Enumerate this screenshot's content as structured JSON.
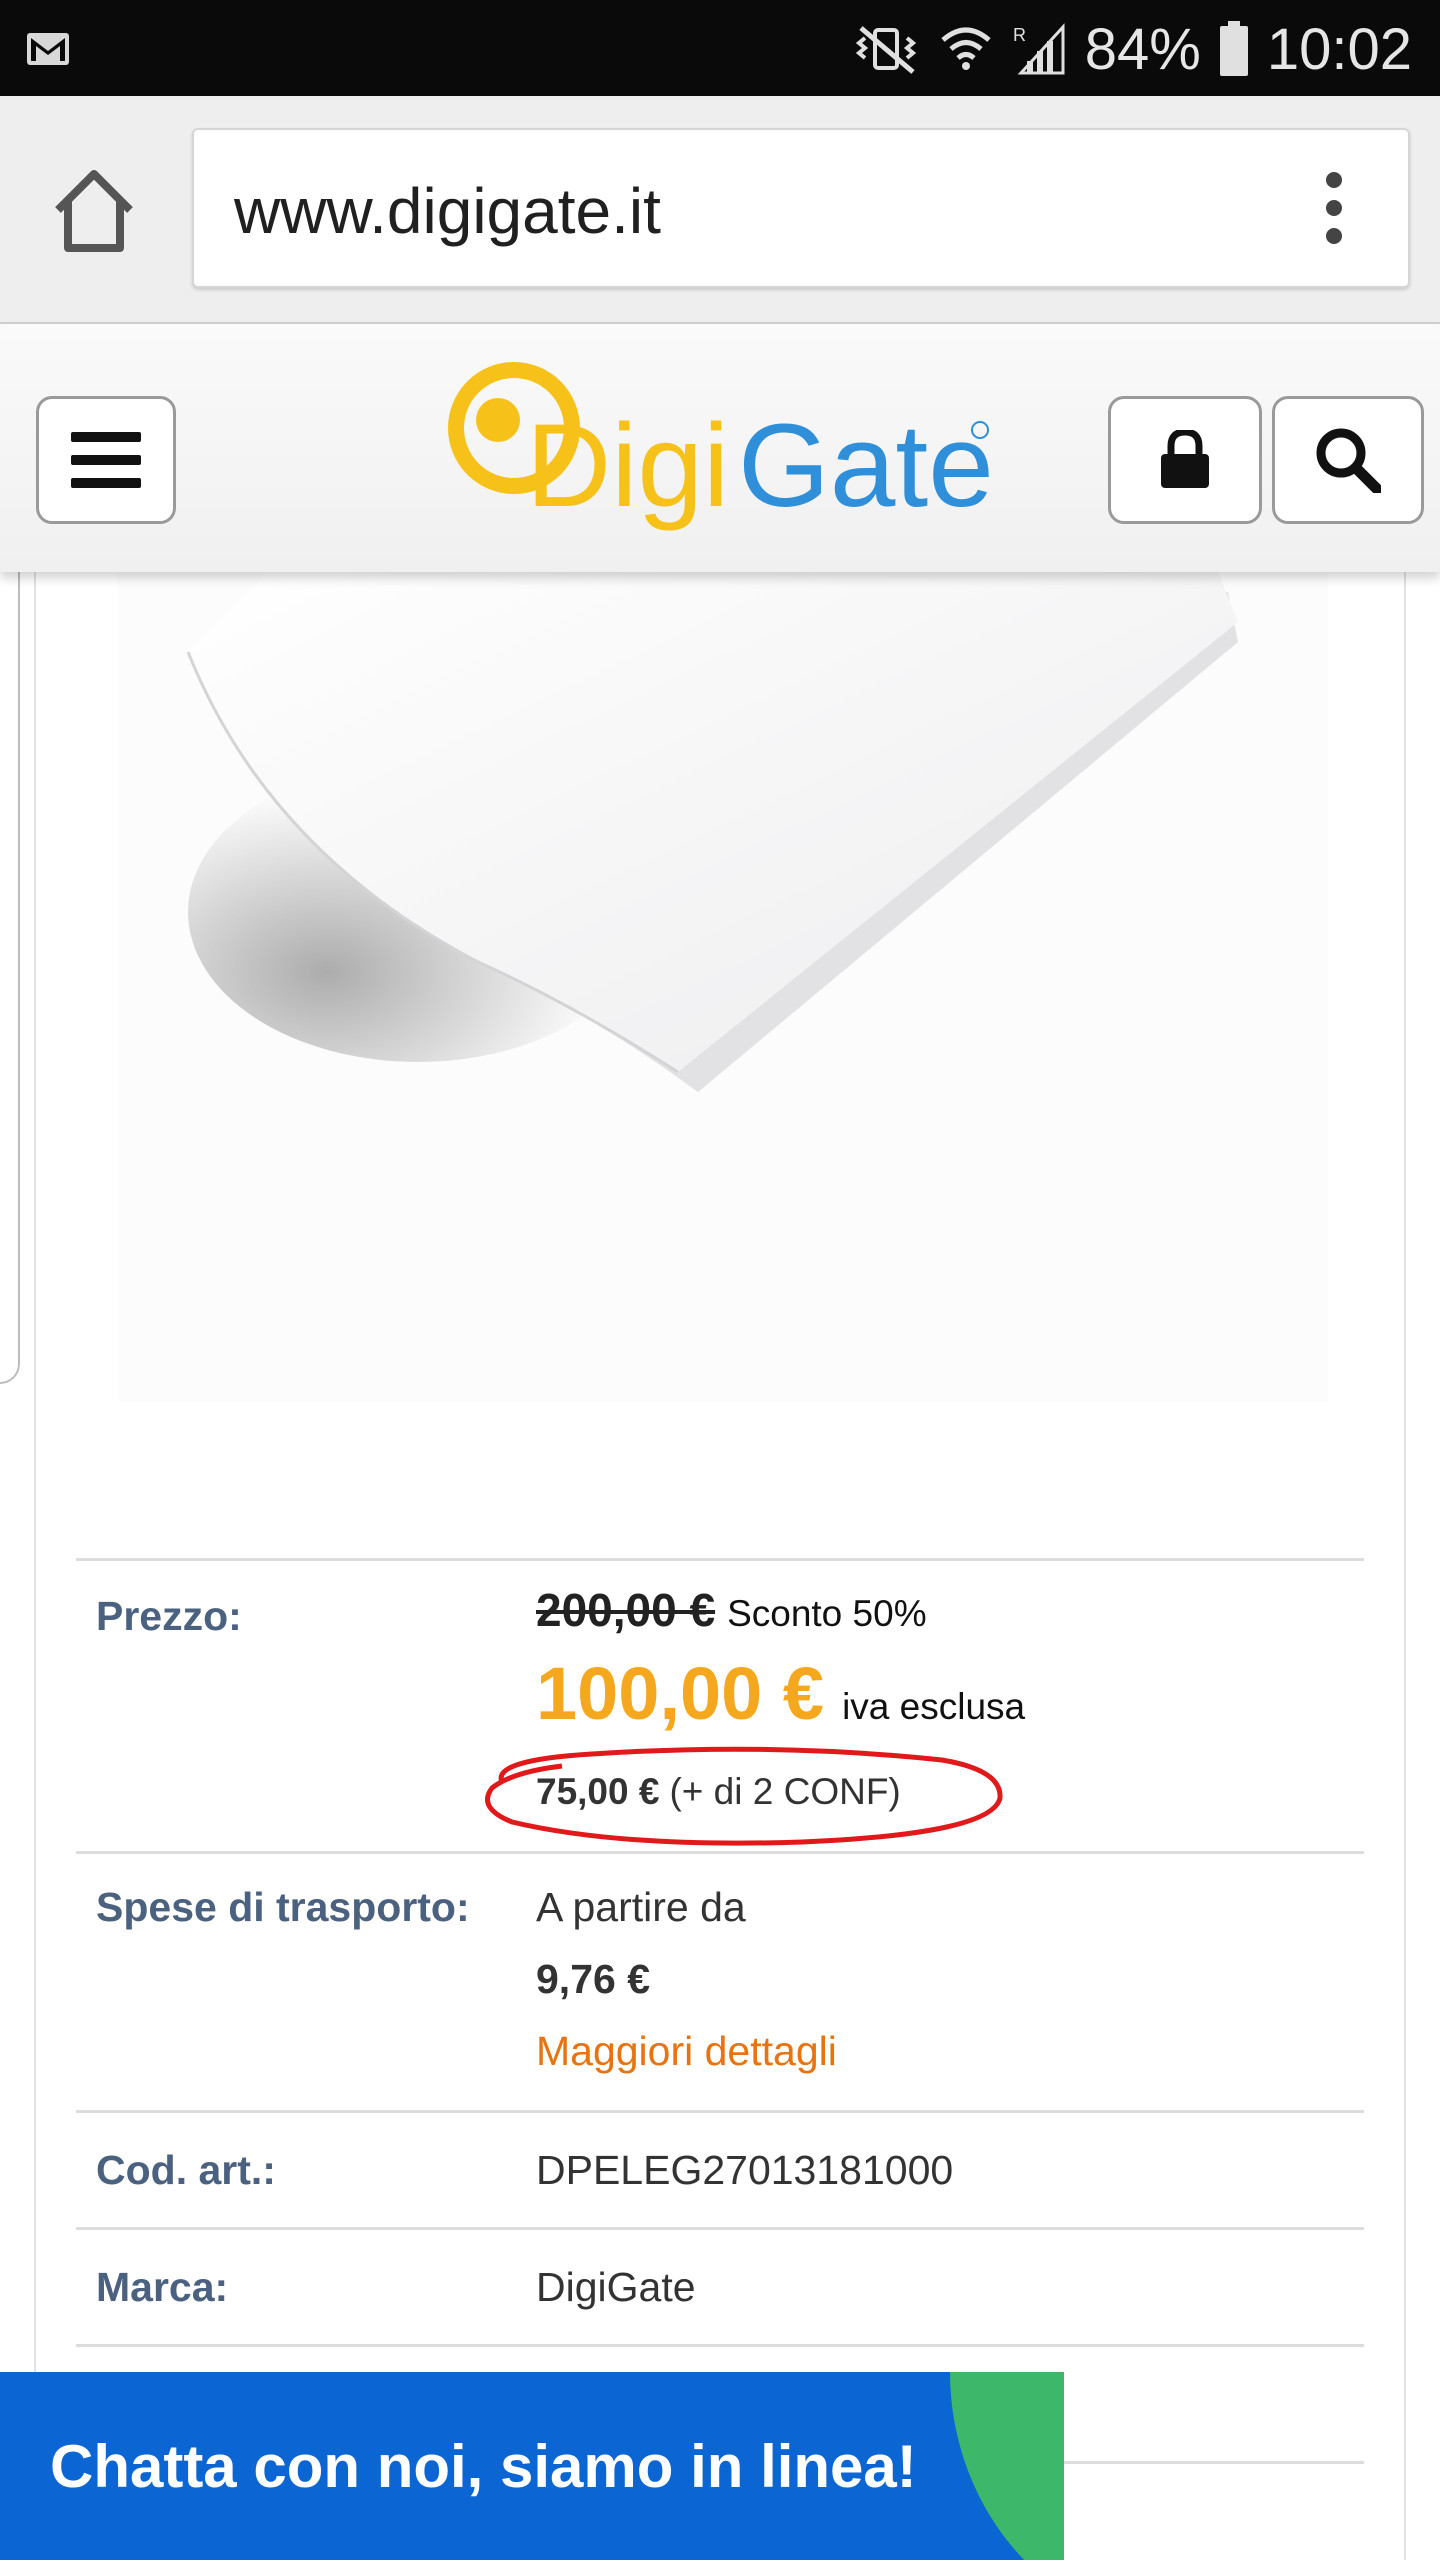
{
  "status_bar": {
    "battery": "84%",
    "time": "10:02"
  },
  "browser": {
    "url": "www.digigate.it"
  },
  "site": {
    "logo_text": "DigiGate",
    "colors": {
      "logo_yellow": "#f6c21a",
      "logo_blue": "#2f8fd8",
      "label_blue": "#4b6180",
      "price_orange": "#f5a81d",
      "link_orange": "#e8730f",
      "chat_blue": "#0b66d4",
      "chat_green": "#3db86a"
    }
  },
  "product": {
    "price_label": "Prezzo:",
    "old_price": "200,00 €",
    "discount": "Sconto 50%",
    "price": "100,00 €",
    "vat_note": "iva esclusa",
    "bulk_price": "75,00 €",
    "bulk_note": "(+ di 2 CONF)",
    "shipping_label": "Spese di trasporto:",
    "shipping_from": "A partire da",
    "shipping_price": "9,76 €",
    "shipping_details": "Maggiori dettagli",
    "code_label": "Cod. art.:",
    "code_value": "DPELEG27013181000",
    "brand_label": "Marca:",
    "brand_value": "DigiGate"
  },
  "chat": {
    "label": "Chatta con noi, siamo in linea!"
  }
}
